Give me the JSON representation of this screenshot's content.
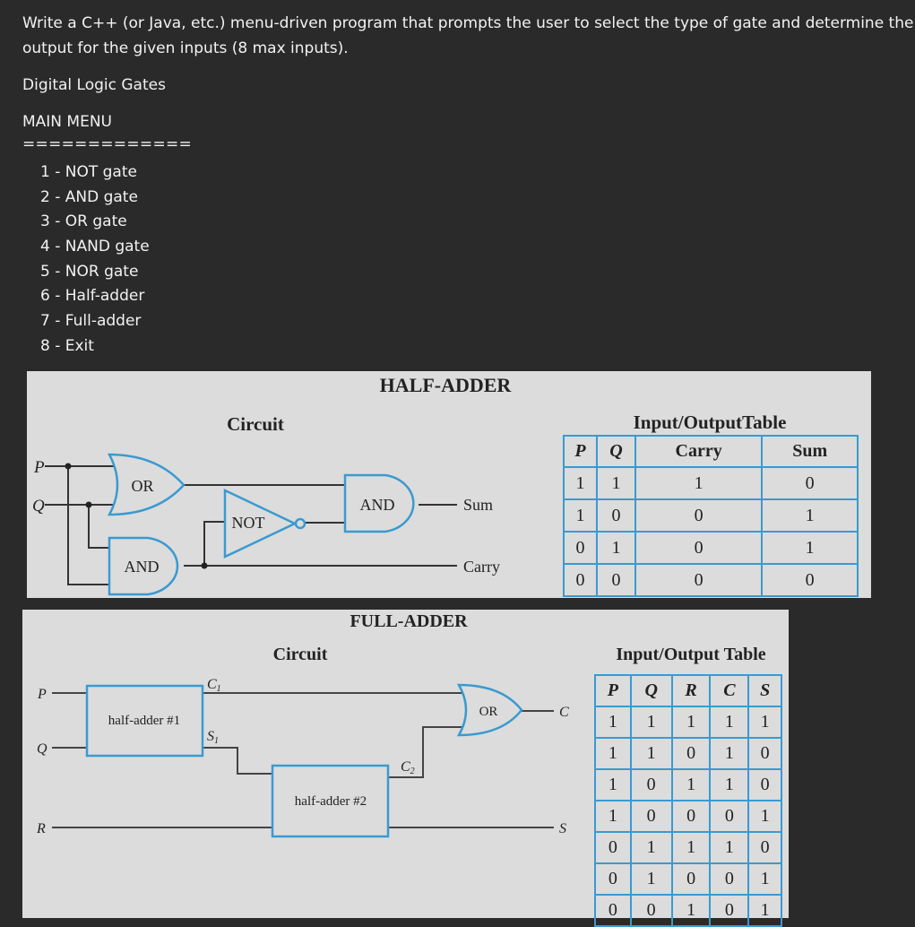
{
  "question": {
    "line1": "Write a C++ (or Java, etc.) menu-driven program that prompts the user to select the type of gate and determine the",
    "line2": "output for the  given inputs (8 max inputs).",
    "subtitle": "Digital Logic Gates",
    "menu_title": "MAIN MENU",
    "separator": "=============",
    "menu_items": [
      "1 - NOT gate",
      "2 - AND gate",
      "3 - OR gate",
      "4 - NAND gate",
      "5 - NOR gate",
      "6 - Half-adder",
      "7 - Full-adder",
      "8 - Exit"
    ]
  },
  "colors": {
    "background": "#2a2a2a",
    "figure_bg": "#dcdcdc",
    "gate_blue": "#3a9ad0"
  },
  "half_adder": {
    "title": "HALF-ADDER",
    "circuit_label": "Circuit",
    "table_title": "Input/OutputTable",
    "inputs": [
      "P",
      "Q"
    ],
    "gates": {
      "or": "OR",
      "and_bottom": "AND",
      "not": "NOT",
      "and_top": "AND"
    },
    "outputs": {
      "sum": "Sum",
      "carry": "Carry"
    },
    "table_headers": [
      "P",
      "Q",
      "Carry",
      "Sum"
    ],
    "table_rows": [
      [
        "1",
        "1",
        "1",
        "0"
      ],
      [
        "1",
        "0",
        "0",
        "1"
      ],
      [
        "0",
        "1",
        "0",
        "1"
      ],
      [
        "0",
        "0",
        "0",
        "0"
      ]
    ]
  },
  "full_adder": {
    "title": "FULL-ADDER",
    "circuit_label": "Circuit",
    "table_title": "Input/Output Table",
    "inputs": [
      "P",
      "Q",
      "R"
    ],
    "blocks": {
      "ha1": "half-adder #1",
      "ha2": "half-adder #2",
      "or": "OR"
    },
    "signals": {
      "c1": "C",
      "c1_sub": "1",
      "s1": "S",
      "s1_sub": "1",
      "c2": "C",
      "c2_sub": "2"
    },
    "outputs": {
      "c": "C",
      "s": "S"
    },
    "table_headers": [
      "P",
      "Q",
      "R",
      "C",
      "S"
    ],
    "table_rows": [
      [
        "1",
        "1",
        "1",
        "1",
        "1"
      ],
      [
        "1",
        "1",
        "0",
        "1",
        "0"
      ],
      [
        "1",
        "0",
        "1",
        "1",
        "0"
      ],
      [
        "1",
        "0",
        "0",
        "0",
        "1"
      ],
      [
        "0",
        "1",
        "1",
        "1",
        "0"
      ],
      [
        "0",
        "1",
        "0",
        "0",
        "1"
      ],
      [
        "0",
        "0",
        "1",
        "0",
        "1"
      ]
    ]
  }
}
